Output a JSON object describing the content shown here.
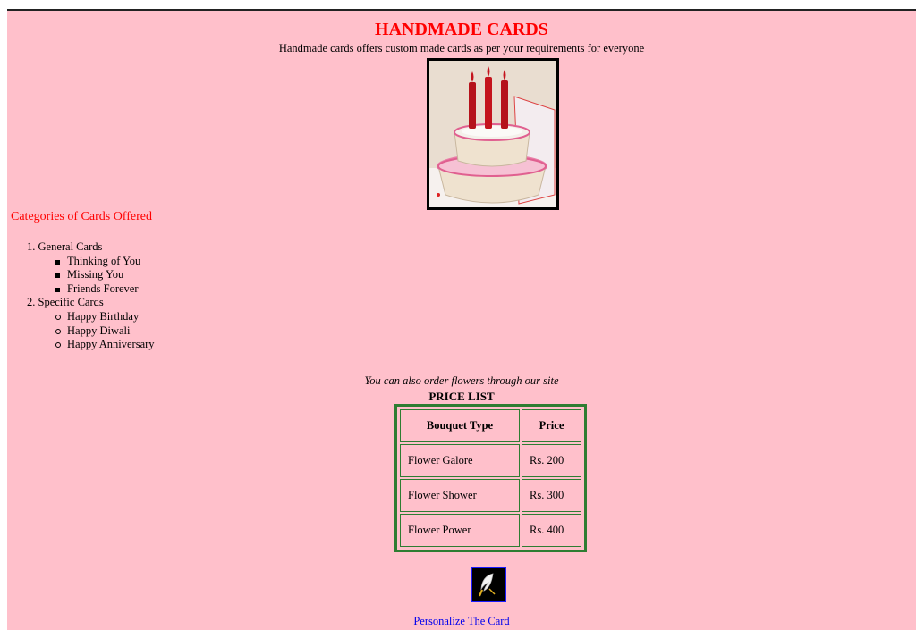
{
  "header": {
    "title": "HANDMADE CARDS",
    "subtitle": "Handmade cards offers custom made cards as per your requirements for everyone"
  },
  "categories": {
    "heading": "Categories of Cards Offered",
    "groups": [
      {
        "label": "1. General Cards",
        "items": [
          "Thinking of You",
          "Missing You",
          "Friends Forever"
        ]
      },
      {
        "label": "2. Specific Cards",
        "items": [
          "Happy Birthday",
          "Happy Diwali",
          "Happy Anniversary"
        ]
      }
    ]
  },
  "flowers": {
    "note": "You can also order flowers through our site",
    "price_title": "PRICE LIST",
    "columns": [
      "Bouquet Type",
      "Price"
    ],
    "rows": [
      [
        "Flower Galore",
        "Rs. 200"
      ],
      [
        "Flower Shower",
        "Rs. 300"
      ],
      [
        "Flower Power",
        "Rs. 400"
      ]
    ]
  },
  "personalize": {
    "icon": "quill-pen-icon",
    "link_text": "Personalize The Card"
  },
  "colors": {
    "background": "#ffc0cb",
    "title": "#ff0000",
    "table_border": "#2e7d32",
    "link": "#0000ee"
  }
}
